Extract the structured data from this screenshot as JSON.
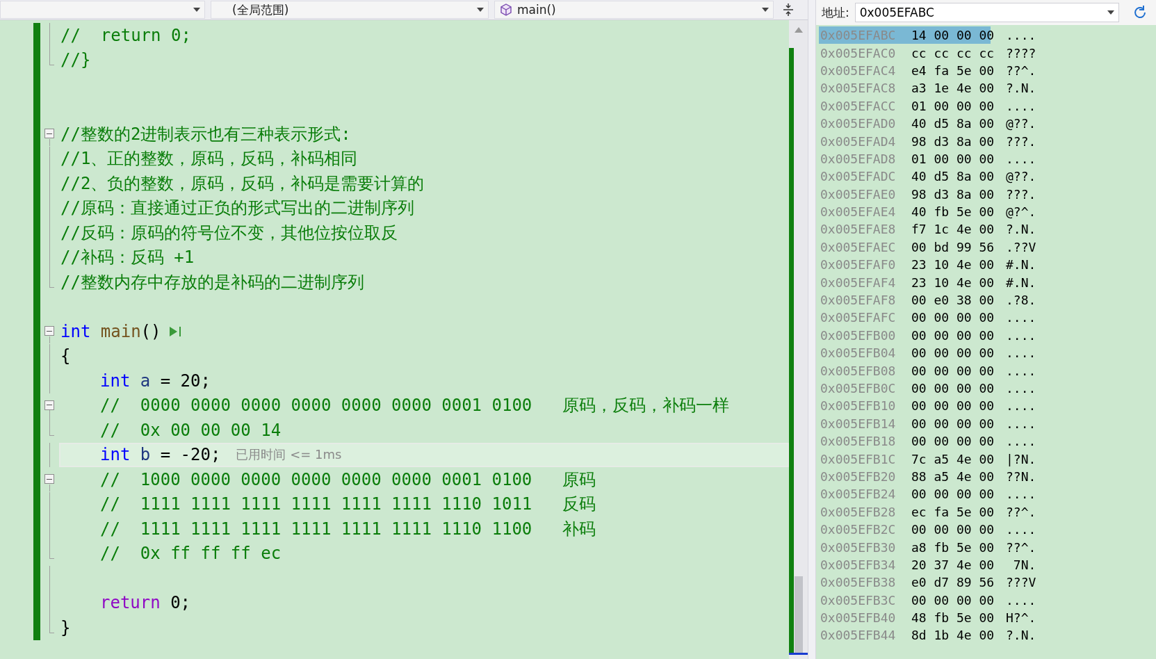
{
  "nav_bar": {
    "dropdowns": [
      {
        "kind": "plain"
      },
      {
        "kind": "plain",
        "value": "(全局范围)"
      },
      {
        "kind": "function",
        "value": "main()"
      }
    ]
  },
  "editor": {
    "lines": [
      {
        "fold_box": false,
        "fold_line": true,
        "fold_end": false,
        "current": false,
        "indented": false,
        "tokens": [
          {
            "kind": "comment",
            "t": "//  return 0;"
          }
        ]
      },
      {
        "fold_box": false,
        "fold_line": false,
        "fold_end": true,
        "current": false,
        "indented": false,
        "tokens": [
          {
            "kind": "comment",
            "t": "//}"
          }
        ]
      },
      {
        "current": false
      },
      {
        "current": false
      },
      {
        "fold_box": true,
        "fold_line": false,
        "fold_end": false,
        "current": false,
        "indented": false,
        "tokens": [
          {
            "kind": "comment",
            "t": "//整数的2进制表示也有三种表示形式:"
          }
        ]
      },
      {
        "fold_box": false,
        "fold_line": true,
        "fold_end": false,
        "current": false,
        "indented": false,
        "tokens": [
          {
            "kind": "comment",
            "t": "//1、正的整数，原码，反码，补码相同"
          }
        ]
      },
      {
        "fold_box": false,
        "fold_line": true,
        "fold_end": false,
        "current": false,
        "indented": false,
        "tokens": [
          {
            "kind": "comment",
            "t": "//2、负的整数，原码，反码，补码是需要计算的"
          }
        ]
      },
      {
        "fold_box": false,
        "fold_line": true,
        "fold_end": false,
        "current": false,
        "indented": false,
        "tokens": [
          {
            "kind": "comment",
            "t": "//原码：直接通过正负的形式写出的二进制序列"
          }
        ]
      },
      {
        "fold_box": false,
        "fold_line": true,
        "fold_end": false,
        "current": false,
        "indented": false,
        "tokens": [
          {
            "kind": "comment",
            "t": "//反码：原码的符号位不变，其他位按位取反"
          }
        ]
      },
      {
        "fold_box": false,
        "fold_line": true,
        "fold_end": false,
        "current": false,
        "indented": false,
        "tokens": [
          {
            "kind": "comment",
            "t": "//补码：反码 +1"
          }
        ]
      },
      {
        "fold_box": false,
        "fold_line": false,
        "fold_end": true,
        "current": false,
        "indented": false,
        "tokens": [
          {
            "kind": "comment",
            "t": "//整数内存中存放的是补码的二进制序列"
          }
        ]
      },
      {
        "current": false
      },
      {
        "fold_box": true,
        "fold_line": false,
        "fold_end": false,
        "current": false,
        "indented": false,
        "run_icon": true,
        "tokens": [
          {
            "kind": "keyword",
            "t": "int"
          },
          {
            "kind": "function",
            "t": " main"
          },
          {
            "kind": "plain",
            "t": "()"
          }
        ]
      },
      {
        "fold_box": false,
        "fold_line": true,
        "fold_end": false,
        "current": false,
        "indented": false,
        "tokens": [
          {
            "kind": "plain",
            "t": "{"
          }
        ]
      },
      {
        "fold_box": false,
        "fold_line": true,
        "fold_end": false,
        "current": false,
        "indented": true,
        "tokens": [
          {
            "kind": "keyword",
            "t": "int"
          },
          {
            "kind": "variable",
            "t": " a"
          },
          {
            "kind": "plain",
            "t": " = 20;"
          }
        ]
      },
      {
        "fold_box": true,
        "fold_line": false,
        "fold_end": false,
        "current": false,
        "indented": true,
        "tokens": [
          {
            "kind": "comment",
            "t": "//  0000 0000 0000 0000 0000 0000 0001 0100   原码，反码，补码一样"
          }
        ]
      },
      {
        "fold_box": false,
        "fold_line": false,
        "fold_end": true,
        "current": false,
        "indented": true,
        "tokens": [
          {
            "kind": "comment",
            "t": "//  0x 00 00 00 14"
          }
        ]
      },
      {
        "fold_box": false,
        "fold_line": true,
        "fold_end": false,
        "current": true,
        "indented": true,
        "hint": "已用时间 <= 1ms",
        "tokens": [
          {
            "kind": "keyword",
            "t": "int"
          },
          {
            "kind": "variable",
            "t": " b"
          },
          {
            "kind": "plain",
            "t": " = -20;"
          }
        ]
      },
      {
        "fold_box": true,
        "fold_line": false,
        "fold_end": false,
        "current": false,
        "indented": true,
        "tokens": [
          {
            "kind": "comment",
            "t": "//  1000 0000 0000 0000 0000 0000 0001 0100   原码"
          }
        ]
      },
      {
        "fold_box": false,
        "fold_line": true,
        "fold_end": false,
        "current": false,
        "indented": true,
        "tokens": [
          {
            "kind": "comment",
            "t": "//  1111 1111 1111 1111 1111 1111 1110 1011   反码"
          }
        ]
      },
      {
        "fold_box": false,
        "fold_line": true,
        "fold_end": false,
        "current": false,
        "indented": true,
        "tokens": [
          {
            "kind": "comment",
            "t": "//  1111 1111 1111 1111 1111 1111 1110 1100   补码"
          }
        ]
      },
      {
        "fold_box": false,
        "fold_line": false,
        "fold_end": true,
        "current": false,
        "indented": true,
        "tokens": [
          {
            "kind": "comment",
            "t": "//  0x ff ff ff ec"
          }
        ]
      },
      {
        "fold_box": false,
        "fold_line": true,
        "fold_end": false,
        "current": false
      },
      {
        "fold_box": false,
        "fold_line": true,
        "fold_end": false,
        "current": false,
        "indented": true,
        "tokens": [
          {
            "kind": "control",
            "t": "return"
          },
          {
            "kind": "plain",
            "t": " 0;"
          }
        ]
      },
      {
        "fold_box": false,
        "fold_line": false,
        "fold_end": true,
        "current": false,
        "indented": false,
        "tokens": [
          {
            "kind": "plain",
            "t": "}"
          }
        ]
      }
    ]
  },
  "memory": {
    "address_label": "地址:",
    "address_value": "0x005EFABC",
    "rows": [
      {
        "address": "0x005EFABC",
        "bytes": "14 00 00 00",
        "chars": "....",
        "selected": true
      },
      {
        "address": "0x005EFAC0",
        "bytes": "cc cc cc cc",
        "chars": "????",
        "selected": false
      },
      {
        "address": "0x005EFAC4",
        "bytes": "e4 fa 5e 00",
        "chars": "??^.",
        "selected": false
      },
      {
        "address": "0x005EFAC8",
        "bytes": "a3 1e 4e 00",
        "chars": "?.N.",
        "selected": false
      },
      {
        "address": "0x005EFACC",
        "bytes": "01 00 00 00",
        "chars": "....",
        "selected": false
      },
      {
        "address": "0x005EFAD0",
        "bytes": "40 d5 8a 00",
        "chars": "@??.",
        "selected": false
      },
      {
        "address": "0x005EFAD4",
        "bytes": "98 d3 8a 00",
        "chars": "???.",
        "selected": false
      },
      {
        "address": "0x005EFAD8",
        "bytes": "01 00 00 00",
        "chars": "....",
        "selected": false
      },
      {
        "address": "0x005EFADC",
        "bytes": "40 d5 8a 00",
        "chars": "@??.",
        "selected": false
      },
      {
        "address": "0x005EFAE0",
        "bytes": "98 d3 8a 00",
        "chars": "???.",
        "selected": false
      },
      {
        "address": "0x005EFAE4",
        "bytes": "40 fb 5e 00",
        "chars": "@?^.",
        "selected": false
      },
      {
        "address": "0x005EFAE8",
        "bytes": "f7 1c 4e 00",
        "chars": "?.N.",
        "selected": false
      },
      {
        "address": "0x005EFAEC",
        "bytes": "00 bd 99 56",
        "chars": ".??V",
        "selected": false
      },
      {
        "address": "0x005EFAF0",
        "bytes": "23 10 4e 00",
        "chars": "#.N.",
        "selected": false
      },
      {
        "address": "0x005EFAF4",
        "bytes": "23 10 4e 00",
        "chars": "#.N.",
        "selected": false
      },
      {
        "address": "0x005EFAF8",
        "bytes": "00 e0 38 00",
        "chars": ".?8.",
        "selected": false
      },
      {
        "address": "0x005EFAFC",
        "bytes": "00 00 00 00",
        "chars": "....",
        "selected": false
      },
      {
        "address": "0x005EFB00",
        "bytes": "00 00 00 00",
        "chars": "....",
        "selected": false
      },
      {
        "address": "0x005EFB04",
        "bytes": "00 00 00 00",
        "chars": "....",
        "selected": false
      },
      {
        "address": "0x005EFB08",
        "bytes": "00 00 00 00",
        "chars": "....",
        "selected": false
      },
      {
        "address": "0x005EFB0C",
        "bytes": "00 00 00 00",
        "chars": "....",
        "selected": false
      },
      {
        "address": "0x005EFB10",
        "bytes": "00 00 00 00",
        "chars": "....",
        "selected": false
      },
      {
        "address": "0x005EFB14",
        "bytes": "00 00 00 00",
        "chars": "....",
        "selected": false
      },
      {
        "address": "0x005EFB18",
        "bytes": "00 00 00 00",
        "chars": "....",
        "selected": false
      },
      {
        "address": "0x005EFB1C",
        "bytes": "7c a5 4e 00",
        "chars": "|?N.",
        "selected": false
      },
      {
        "address": "0x005EFB20",
        "bytes": "88 a5 4e 00",
        "chars": "??N.",
        "selected": false
      },
      {
        "address": "0x005EFB24",
        "bytes": "00 00 00 00",
        "chars": "....",
        "selected": false
      },
      {
        "address": "0x005EFB28",
        "bytes": "ec fa 5e 00",
        "chars": "??^.",
        "selected": false
      },
      {
        "address": "0x005EFB2C",
        "bytes": "00 00 00 00",
        "chars": "....",
        "selected": false
      },
      {
        "address": "0x005EFB30",
        "bytes": "a8 fb 5e 00",
        "chars": "??^.",
        "selected": false
      },
      {
        "address": "0x005EFB34",
        "bytes": "20 37 4e 00",
        "chars": " 7N.",
        "selected": false
      },
      {
        "address": "0x005EFB38",
        "bytes": "e0 d7 89 56",
        "chars": "???V",
        "selected": false
      },
      {
        "address": "0x005EFB3C",
        "bytes": "00 00 00 00",
        "chars": "....",
        "selected": false
      },
      {
        "address": "0x005EFB40",
        "bytes": "48 fb 5e 00",
        "chars": "H?^.",
        "selected": false
      },
      {
        "address": "0x005EFB44",
        "bytes": "8d 1b 4e 00",
        "chars": "?.N.",
        "selected": false
      }
    ]
  }
}
